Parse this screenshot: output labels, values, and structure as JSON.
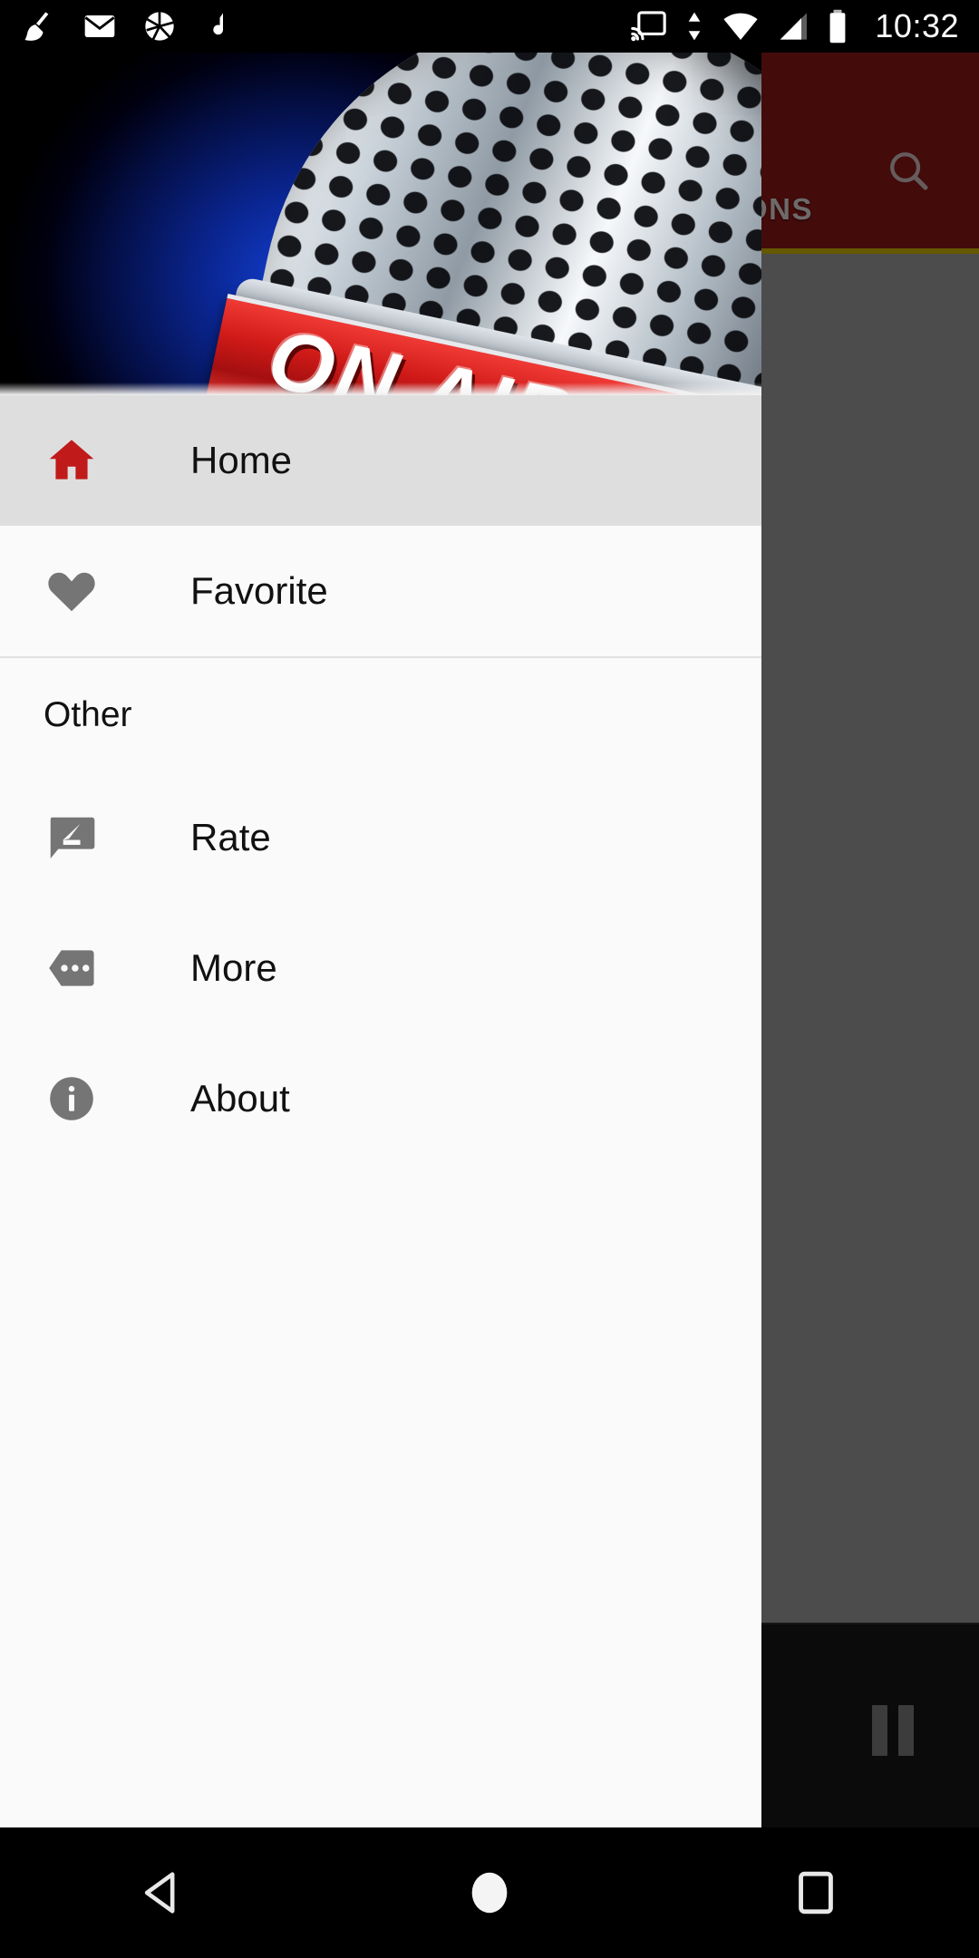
{
  "status_bar": {
    "time": "10:32",
    "left_icons": [
      "broom-icon",
      "email-icon",
      "camera-aperture-icon",
      "music-note-icon"
    ],
    "right_icons": [
      "cast-icon",
      "data-transfer-icon",
      "wifi-icon",
      "cellular-signal-icon",
      "battery-icon"
    ]
  },
  "toolbar": {
    "search_icon": "search-icon",
    "accent_color": "#7c1414",
    "tab_indicator_color": "#b8a000",
    "tabs": [
      {
        "label": "STATIONS",
        "selected": true
      }
    ]
  },
  "player": {
    "pause_icon": "pause-icon",
    "background_color": "#141414"
  },
  "drawer": {
    "header": {
      "artwork_name": "on-air-microphone-banner",
      "banner_text": "ON AIR"
    },
    "items": [
      {
        "label": "Home",
        "icon": "home-icon",
        "selected": true,
        "icon_color": "#c01a1a"
      },
      {
        "label": "Favorite",
        "icon": "heart-icon",
        "selected": false,
        "icon_color": "#757575"
      }
    ],
    "section_title": "Other",
    "other_items": [
      {
        "label": "Rate",
        "icon": "rate-comment-edit-icon",
        "icon_color": "#757575"
      },
      {
        "label": "More",
        "icon": "more-tag-icon",
        "icon_color": "#757575"
      },
      {
        "label": "About",
        "icon": "info-circle-icon",
        "icon_color": "#757575"
      }
    ]
  },
  "nav_bar": {
    "buttons": [
      {
        "name": "back-button",
        "icon": "back-triangle-icon"
      },
      {
        "name": "home-button",
        "icon": "home-circle-icon"
      },
      {
        "name": "recents-button",
        "icon": "recents-square-icon"
      }
    ]
  }
}
